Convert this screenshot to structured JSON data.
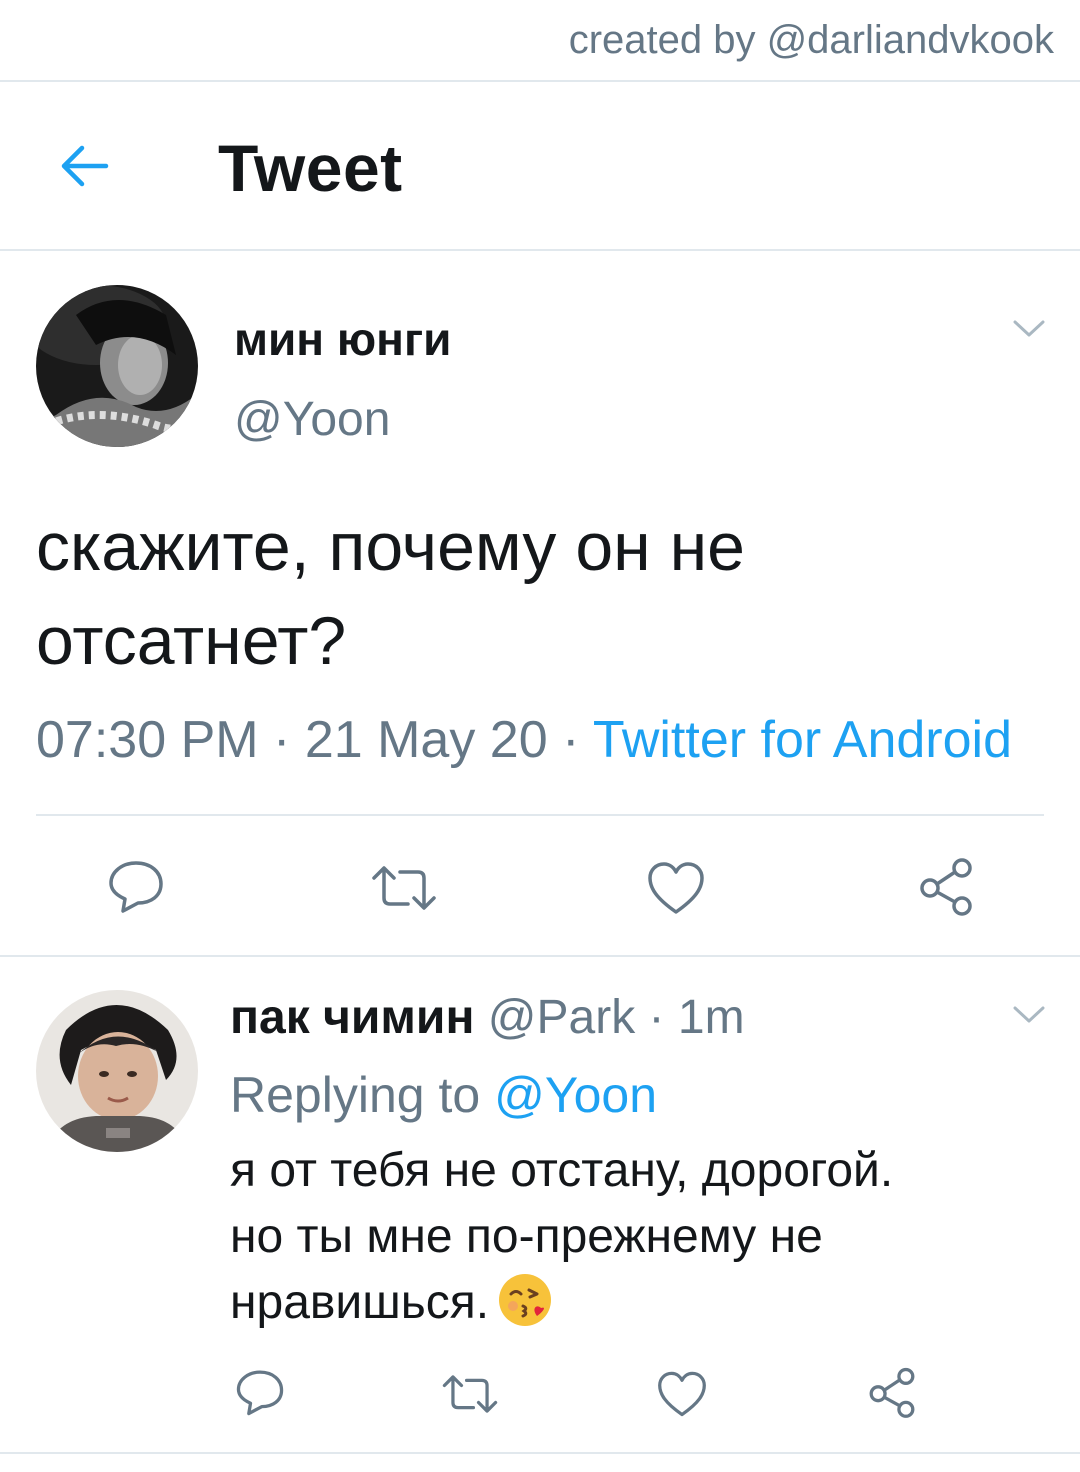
{
  "watermark": "created by @darliandvkook",
  "header": {
    "title": "Tweet",
    "back_icon": "arrow-left-icon"
  },
  "tweet": {
    "display_name": "мин юнги",
    "handle": "@Yoon",
    "text_line1": "скажите, почему он не",
    "text_line2": "отсатнет?",
    "time": "07:30 PM",
    "date": "21 May 20",
    "separator": "·",
    "source": "Twitter for Android",
    "actions": [
      "reply-icon",
      "retweet-icon",
      "like-icon",
      "share-icon"
    ]
  },
  "reply": {
    "display_name": "пак чимин",
    "handle": "@Park",
    "separator": "·",
    "age": "1m",
    "replying_prefix": "Replying to",
    "replying_to": "@Yoon",
    "text_line1": "я от тебя не отстану, дорогой.",
    "text_line2": "но ты мне по-прежнему не",
    "text_line3": "нравишься.",
    "emoji": "face-blowing-kiss-emoji",
    "actions": [
      "reply-icon",
      "retweet-icon",
      "like-icon",
      "share-icon"
    ]
  },
  "colors": {
    "accent": "#1da1f2",
    "secondary_text": "#657786",
    "divider": "#e1e8ed"
  }
}
